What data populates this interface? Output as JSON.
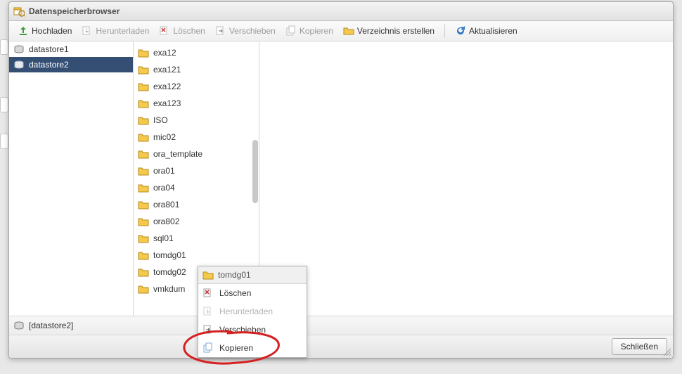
{
  "window": {
    "title": "Datenspeicherbrowser"
  },
  "toolbar": {
    "upload": "Hochladen",
    "download": "Herunterladen",
    "delete": "Löschen",
    "move": "Verschieben",
    "copy": "Kopieren",
    "mkdir": "Verzeichnis erstellen",
    "refresh": "Aktualisieren"
  },
  "datastores": {
    "items": [
      {
        "label": "datastore1",
        "selected": false
      },
      {
        "label": "datastore2",
        "selected": true
      }
    ]
  },
  "folders": {
    "items": [
      "exa12",
      "exa121",
      "exa122",
      "exa123",
      "ISO",
      "mic02",
      "ora_template",
      "ora01",
      "ora04",
      "ora801",
      "ora802",
      "sql01",
      "tomdg01",
      "tomdg02",
      "vmkdum"
    ]
  },
  "context_menu": {
    "target": "tomdg01",
    "items": [
      {
        "key": "delete",
        "label": "Löschen",
        "enabled": true
      },
      {
        "key": "download",
        "label": "Herunterladen",
        "enabled": false
      },
      {
        "key": "move",
        "label": "Verschieben",
        "enabled": true
      },
      {
        "key": "copy",
        "label": "Kopieren",
        "enabled": true
      }
    ]
  },
  "statusbar": {
    "path": "[datastore2]"
  },
  "footer": {
    "close": "Schließen"
  }
}
